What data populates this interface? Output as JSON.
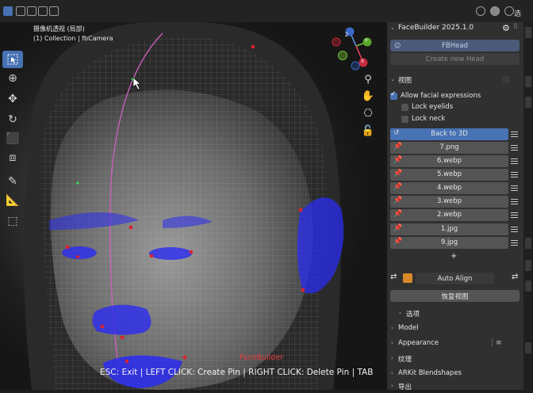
{
  "header": {
    "title_hint": ""
  },
  "viewport": {
    "title_line1": "摄像机透视 (局部)",
    "title_line2": "(1) Collection | fbCamera",
    "hint_text": "ESC: Exit | LEFT CLICK: Create Pin | RIGHT CLICK: Delete Pin | TAB",
    "overlay_label": "FaceBuilder",
    "gizmo_axes": {
      "x": "X",
      "y": "Y",
      "z": "Z"
    }
  },
  "panel": {
    "title": "FaceBuilder 2025.1.0",
    "head_button": "FBHead",
    "create_button": "Create new Head",
    "view_section": "视图",
    "allow_expressions": "Allow facial expressions",
    "lock_eyelids": "Lock eyelids",
    "lock_neck": "Lock neck",
    "back_to_3d": "Back to 3D",
    "images": [
      "7.png",
      "6.webp",
      "5.webp",
      "4.webp",
      "3.webp",
      "2.webp",
      "1.jpg",
      "9.jpg"
    ],
    "add": "+",
    "auto_align": "Auto Align",
    "restore_view": "恢复视图",
    "options": "选项",
    "sections": [
      "Model",
      "Appearance",
      "纹理",
      "ARKit Blendshapes",
      "导出"
    ]
  },
  "tabs": {
    "view_tab": "选"
  },
  "colors": {
    "accent": "#4772b3",
    "mesh_blue": "#2a2cf0",
    "pin_red": "#e0202a",
    "panel_bg": "#303030"
  }
}
